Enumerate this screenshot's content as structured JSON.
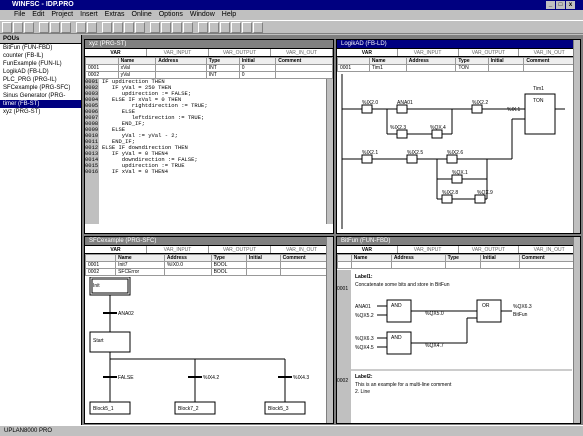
{
  "window": {
    "title": "WINFSC - IDP.PRO"
  },
  "menu": [
    "File",
    "Edit",
    "Project",
    "Insert",
    "Extras",
    "Online",
    "Options",
    "Window",
    "Help"
  ],
  "sidebar": {
    "header": "POUs",
    "items": [
      "BitFun (FUN-FBD)",
      "counter (FB-IL)",
      "FunExample (FUN-IL)",
      "LogikAD (FB-LD)",
      "PLC_PRG (PRG-IL)",
      "SFCexample (PRG-SFC)",
      "Sinus Generator (PRG-",
      "timer (FB-ST)",
      "xyz (PRG-ST)"
    ],
    "selected": 7
  },
  "st_win": {
    "title": "xyz (PRG-ST)",
    "tabs": [
      "VAR",
      "VAR_INPUT",
      "VAR_OUTPUT",
      "VAR_IN_OUT"
    ],
    "cols": [
      "Name",
      "Address",
      "Type",
      "Initial",
      "Comment"
    ],
    "rows": [
      [
        "0001",
        "xVal",
        "",
        "INT",
        "0",
        ""
      ],
      [
        "0002",
        "yVal",
        "",
        "INT",
        "0",
        ""
      ]
    ],
    "code": [
      "IF updirection THEN",
      "   IF yVal = 250 THEN",
      "      updirection := FALSE;",
      "   ELSE IF xVal = 0 THEN",
      "         rightdirection := TRUE;",
      "      ELSE",
      "         leftdirection := TRUE;",
      "      END_IF;",
      "   ELSE",
      "      yVal := yVal - 2;",
      "   END_IF;",
      "ELSE IF downdirection THEN",
      "   IF yVal = 0 THEN4",
      "      downdirection := FALSE;",
      "      updirection := TRUE",
      "   IF xVal = 0 THEN4"
    ],
    "lines": [
      "0001",
      "0002",
      "0003",
      "0004",
      "0005",
      "0006",
      "0007",
      "0008",
      "0009",
      "0010",
      "0011",
      "0012",
      "0013",
      "0014",
      "0015",
      "0016"
    ]
  },
  "ld_win": {
    "title": "LogikAD (FB-LD)",
    "tabs": [
      "VAR",
      "VAR_INPUT",
      "VAR_OUTPUT",
      "VAR_IN_OUT"
    ],
    "cols": [
      "Name",
      "Address",
      "Type",
      "Initial",
      "Comment"
    ],
    "rows": [
      [
        "0001",
        "Tim1",
        "",
        "TON",
        "",
        ""
      ]
    ],
    "contacts": [
      "%IX2.0",
      "ANA01",
      "%IX2.2",
      "%IX2.3",
      "%QX.4",
      "%IX2.1",
      "%IX2.5",
      "%IX2.6",
      "%QX.1",
      "%IX2.8",
      "%QX.9"
    ],
    "timer": "Tim1",
    "timer_type": "TON",
    "in": "IN",
    "coil": "%IX.1"
  },
  "sfc_win": {
    "title": "SFCexample (PRG-SFC)",
    "tabs": [
      "VAR",
      "VAR_INPUT",
      "VAR_OUTPUT",
      "VAR_IN_OUT"
    ],
    "cols": [
      "Name",
      "Address",
      "Type",
      "Initial",
      "Comment"
    ],
    "rows": [
      [
        "0001",
        "Init7",
        "",
        "%IX0.0",
        "BOOL",
        ""
      ],
      [
        "0002",
        "SFCError",
        "",
        "",
        "BOOL",
        ""
      ]
    ],
    "init": "Init",
    "trans1": "ANA02",
    "step": "Start",
    "trans2": "FALSE",
    "trans3": "%IX4.2",
    "trans4": "%IX4.3",
    "blocks": [
      "Block5_1",
      "Block7_2",
      "Block5_3"
    ]
  },
  "fbd_win": {
    "title": "BitFun (FUN-FBD)",
    "tabs": [
      "VAR",
      "VAR_INPUT",
      "VAR_OUTPUT",
      "VAR_IN_OUT"
    ],
    "cols": [
      "Name",
      "Address",
      "Type",
      "Initial",
      "Comment"
    ],
    "label1": "Label1:",
    "comment1": "Concatenate some bits and store in BitFun",
    "and1": "AND",
    "or1": "OR",
    "and2": "AND",
    "inA": "ANA01",
    "inB": "%QX5.2",
    "mid1": "%QX5.0",
    "out1": "%QX6.3",
    "out2": "BitFun",
    "inC": "%QX6.3",
    "inD": "%QX4.5",
    "mid2": "%QX4.7",
    "label2": "Label2:",
    "comment2": "This is an example for a multi-line comment",
    "comment3": "2. Line",
    "lines": [
      "0001",
      "0002"
    ]
  },
  "status": "UPLAN8000 PRO"
}
